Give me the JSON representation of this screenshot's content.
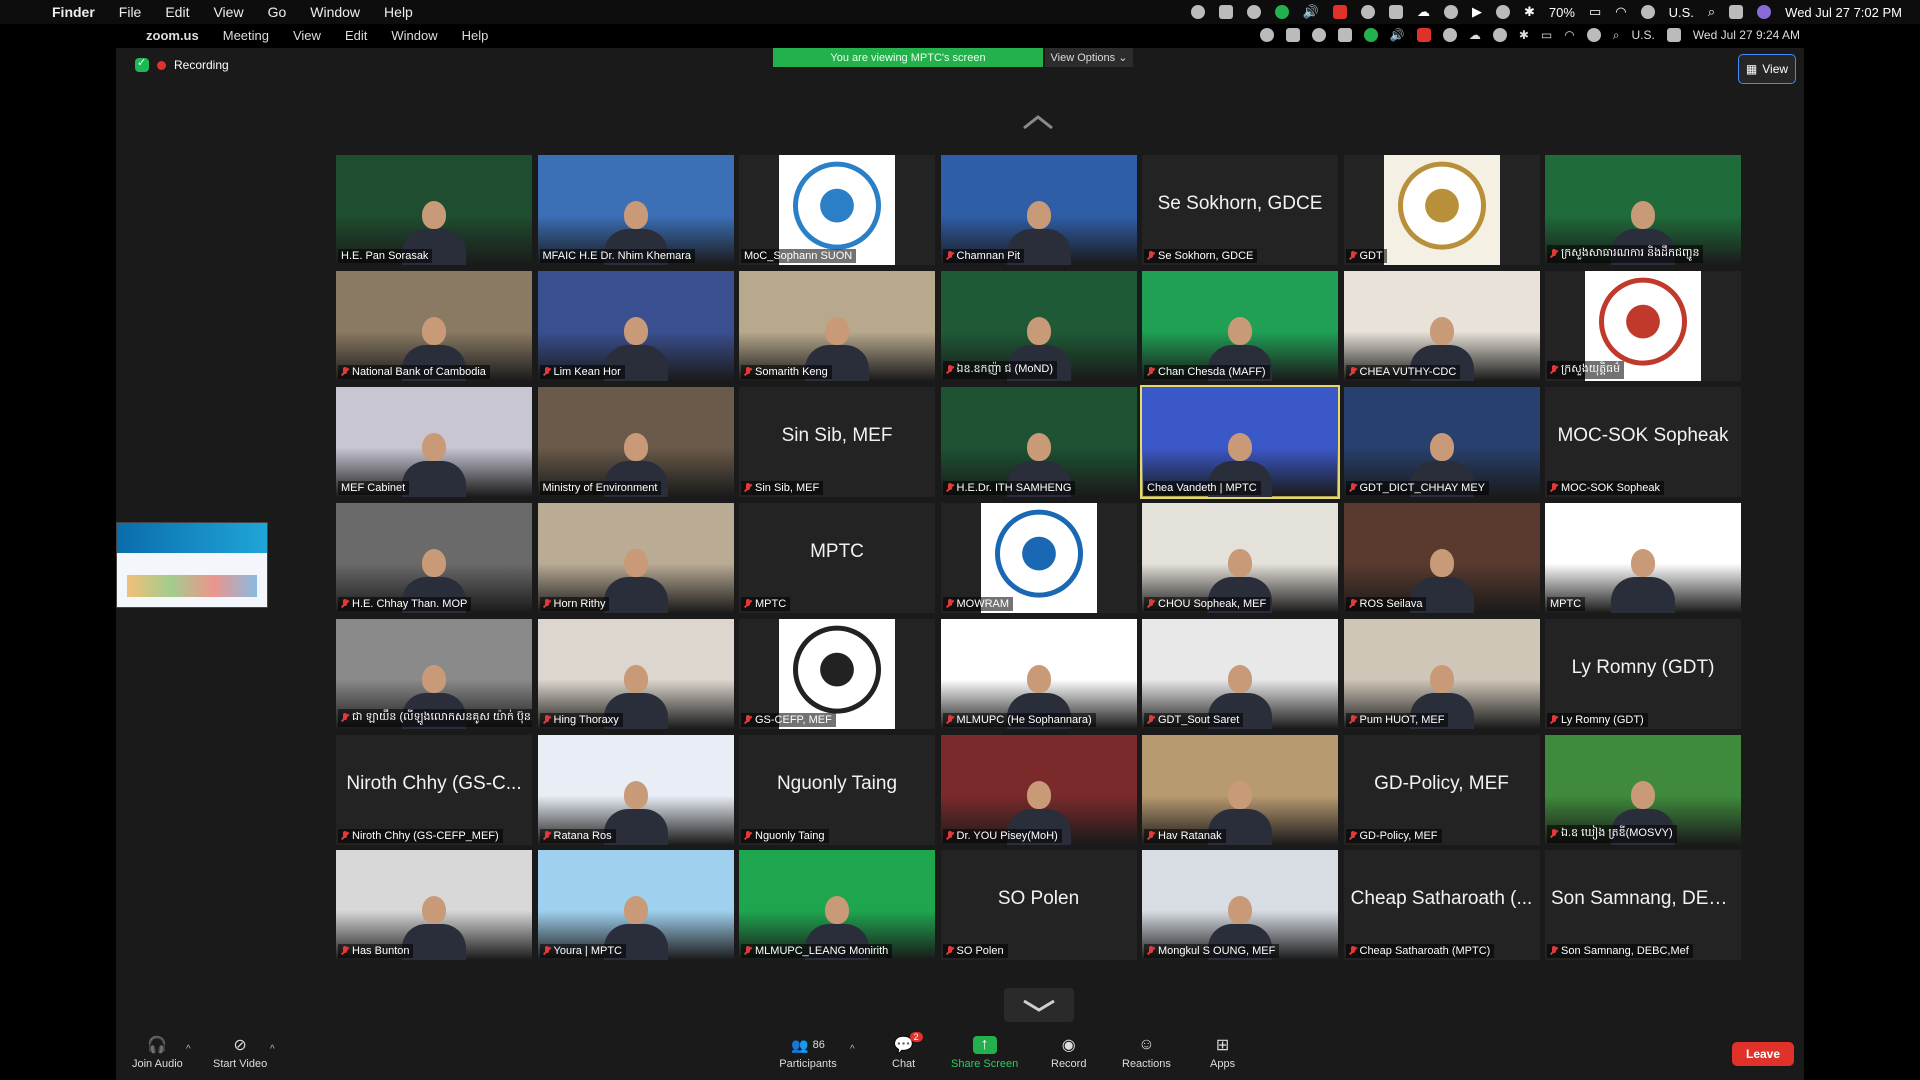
{
  "menubar": {
    "items": [
      "Finder",
      "File",
      "Edit",
      "View",
      "Go",
      "Window",
      "Help"
    ],
    "battery": "70%",
    "input_source": "U.S.",
    "clock": "Wed Jul 27  7:02 PM"
  },
  "remote_menubar": {
    "items": [
      "zoom.us",
      "Meeting",
      "View",
      "Edit",
      "Window",
      "Help"
    ],
    "input_source": "U.S.",
    "clock": "Wed Jul 27  9:24 AM"
  },
  "meeting": {
    "recording_label": "Recording",
    "viewing_banner": "You are viewing MPTC's screen",
    "view_options": "View Options ⌄",
    "view_button": "View"
  },
  "tiles": [
    {
      "name": "H.E. Pan Sorasak",
      "card": "",
      "kind": "video",
      "bg": "#1f4d2f"
    },
    {
      "name": "MFAIC H.E  Dr. Nhim Khemara",
      "card": "",
      "kind": "video",
      "bg": "#3b6fb6"
    },
    {
      "name": "MoC_Sophann SUON",
      "card": "",
      "kind": "logo",
      "bg": "#ffffff",
      "logo": "#2a7fc7"
    },
    {
      "name": "Chamnan Pit",
      "card": "",
      "kind": "video",
      "bg": "#2f5ea8"
    },
    {
      "name": "Se Sokhorn, GDCE",
      "card": "Se Sokhorn, GDCE",
      "kind": "name",
      "bg": "#232323"
    },
    {
      "name": "GDT",
      "card": "",
      "kind": "logo",
      "bg": "#f4f0e4",
      "logo": "#b8903a"
    },
    {
      "name": "ក្រសួងសាធារណការ និងដឹកជញ្ជូន",
      "card": "",
      "kind": "video",
      "bg": "#1f6b3a"
    },
    {
      "name": "National Bank of Cambodia",
      "card": "",
      "kind": "video",
      "bg": "#8a7a64"
    },
    {
      "name": "Lim Kean Hor",
      "card": "",
      "kind": "video",
      "bg": "#3a4f8f"
    },
    {
      "name": "Somarith Keng",
      "card": "",
      "kind": "video",
      "bg": "#b8a98e"
    },
    {
      "name": "ឯឧ.ឧកញ៉ា ជ (MoND)",
      "card": "",
      "kind": "video",
      "bg": "#1e5a36"
    },
    {
      "name": "Chan Chesda (MAFF)",
      "card": "",
      "kind": "video",
      "bg": "#1fa055"
    },
    {
      "name": "CHEA VUTHY-CDC",
      "card": "",
      "kind": "video",
      "bg": "#e8e2d8"
    },
    {
      "name": "ក្រសួងយុត្តិធម៌",
      "card": "",
      "kind": "logo",
      "bg": "#ffffff",
      "logo": "#c0392b"
    },
    {
      "name": "MEF Cabinet",
      "card": "",
      "kind": "video",
      "bg": "#c9c6d4"
    },
    {
      "name": "Ministry of Environment",
      "card": "",
      "kind": "video",
      "bg": "#6a5a4a"
    },
    {
      "name": "Sin Sib, MEF",
      "card": "Sin Sib, MEF",
      "kind": "name",
      "bg": "#232323"
    },
    {
      "name": "H.E.Dr. ITH SAMHENG",
      "card": "",
      "kind": "video",
      "bg": "#1d5233"
    },
    {
      "name": "Chea Vandeth | MPTC",
      "card": "",
      "kind": "video",
      "bg": "#3b58c8",
      "active": true
    },
    {
      "name": "GDT_DICT_CHHAY MEY",
      "card": "",
      "kind": "video",
      "bg": "#28406e"
    },
    {
      "name": "MOC-SOK Sopheak",
      "card": "MOC-SOK Sopheak",
      "kind": "name",
      "bg": "#232323"
    },
    {
      "name": "H.E. Chhay Than. MOP",
      "card": "",
      "kind": "video",
      "bg": "#6a6a6a"
    },
    {
      "name": "Horn Rithy",
      "card": "",
      "kind": "video",
      "bg": "#b9ab94"
    },
    {
      "name": "MPTC",
      "card": "MPTC",
      "kind": "name",
      "bg": "#232323"
    },
    {
      "name": "MOWRAM",
      "card": "",
      "kind": "logo",
      "bg": "#ffffff",
      "logo": "#1a67b3"
    },
    {
      "name": "CHOU Sopheak, MEF",
      "card": "",
      "kind": "video",
      "bg": "#e4e0da"
    },
    {
      "name": "ROS Seilava",
      "card": "",
      "kind": "video",
      "bg": "#5a3a2e"
    },
    {
      "name": "MPTC",
      "card": "",
      "kind": "video",
      "bg": "#ffffff"
    },
    {
      "name": "ជា ឡាយឹន (លីឡូងលោកសនគូស យ៉ាក់ ប៊ុន...",
      "card": "",
      "kind": "video",
      "bg": "#8a8a8a"
    },
    {
      "name": "Hing Thoraxy",
      "card": "",
      "kind": "video",
      "bg": "#ddd6ce"
    },
    {
      "name": "GS-CEFP, MEF",
      "card": "",
      "kind": "logo",
      "bg": "#ffffff",
      "logo": "#222222"
    },
    {
      "name": "MLMUPC (He Sophannara)",
      "card": "",
      "kind": "video",
      "bg": "#ffffff"
    },
    {
      "name": "GDT_Sout Saret",
      "card": "",
      "kind": "video",
      "bg": "#e8e8e8"
    },
    {
      "name": "Pum HUOT, MEF",
      "card": "",
      "kind": "video",
      "bg": "#cfc6b8"
    },
    {
      "name": "Ly Romny (GDT)",
      "card": "Ly Romny (GDT)",
      "kind": "name",
      "bg": "#232323"
    },
    {
      "name": "Niroth Chhy (GS-CEFP_MEF)",
      "card": "Niroth Chhy (GS-C...",
      "kind": "name",
      "bg": "#232323"
    },
    {
      "name": "Ratana Ros",
      "card": "",
      "kind": "video",
      "bg": "#e9eef6"
    },
    {
      "name": "Nguonly Taing",
      "card": "Nguonly Taing",
      "kind": "name",
      "bg": "#232323"
    },
    {
      "name": "Dr. YOU Pisey(MoH)",
      "card": "",
      "kind": "video",
      "bg": "#7a2a2a"
    },
    {
      "name": "Hav Ratanak",
      "card": "",
      "kind": "video",
      "bg": "#b89a70"
    },
    {
      "name": "GD-Policy, MEF",
      "card": "GD-Policy, MEF",
      "kind": "name",
      "bg": "#232323"
    },
    {
      "name": "ឯ.ឧ ឃៀង ត្រឌី(MOSVY)",
      "card": "",
      "kind": "video",
      "bg": "#3f8a3c"
    },
    {
      "name": "Has Bunton",
      "card": "",
      "kind": "video",
      "bg": "#d8d8d8"
    },
    {
      "name": "Youra | MPTC",
      "card": "",
      "kind": "video",
      "bg": "#9fd0ef"
    },
    {
      "name": "MLMUPC_LEANG Monirith",
      "card": "",
      "kind": "video",
      "bg": "#1ea64f"
    },
    {
      "name": "SO Polen",
      "card": "SO Polen",
      "kind": "name",
      "bg": "#232323"
    },
    {
      "name": "Mongkul S OUNG, MEF",
      "card": "",
      "kind": "video",
      "bg": "#d8dde4"
    },
    {
      "name": "Cheap Satharoath (MPTC)",
      "card": "Cheap Satharoath (...",
      "kind": "name",
      "bg": "#232323"
    },
    {
      "name": "Son Samnang, DEBC,Mef",
      "card": "Son Samnang, DEB...",
      "kind": "name",
      "bg": "#232323"
    }
  ],
  "toolbar": {
    "join_audio": "Join Audio",
    "start_video": "Start Video",
    "participants_count": "86",
    "participants": "Participants",
    "chat": "Chat",
    "chat_badge": "2",
    "share_screen": "Share Screen",
    "record": "Record",
    "reactions": "Reactions",
    "apps": "Apps",
    "leave": "Leave"
  }
}
